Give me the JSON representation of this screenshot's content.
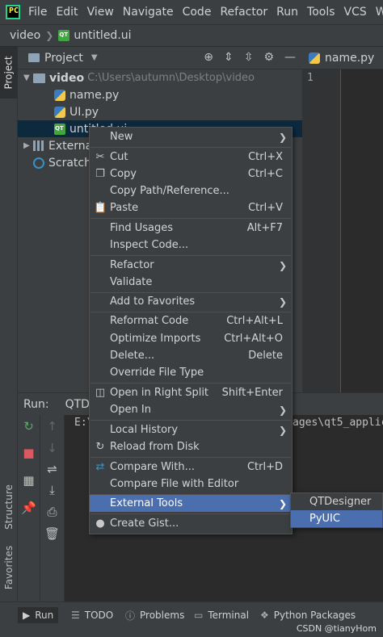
{
  "menubar": {
    "logo": "PC",
    "items": [
      "File",
      "Edit",
      "View",
      "Navigate",
      "Code",
      "Refactor",
      "Run",
      "Tools",
      "VCS",
      "Window"
    ]
  },
  "navbar": {
    "project": "video",
    "file": "untitled.ui"
  },
  "left_strip": {
    "project_tab": "Project",
    "structure_tab": "Structure",
    "favorites_tab": "Favorites"
  },
  "project_panel": {
    "title": "Project",
    "root": {
      "name": "video",
      "path": "C:\\Users\\autumn\\Desktop\\video"
    },
    "files": [
      "name.py",
      "UI.py",
      "untitled.ui"
    ],
    "external": "External Libraries",
    "scratches": "Scratches and Consoles"
  },
  "editor": {
    "tab": "name.py",
    "line_number": "1"
  },
  "run_panel": {
    "label": "Run:",
    "tab": "QTDesigner",
    "console_left": "E:\\",
    "console_right": "ages\\qt5_applic"
  },
  "context_menu": {
    "items": [
      {
        "label": "New",
        "shortcut": "",
        "submenu": true,
        "icon": ""
      },
      {
        "label": "Cut",
        "shortcut": "Ctrl+X",
        "icon": "scissors-icon"
      },
      {
        "label": "Copy",
        "shortcut": "Ctrl+C",
        "icon": "copy-icon"
      },
      {
        "label": "Copy Path/Reference...",
        "shortcut": ""
      },
      {
        "label": "Paste",
        "shortcut": "Ctrl+V",
        "icon": "paste-icon"
      },
      {
        "label": "Find Usages",
        "shortcut": "Alt+F7"
      },
      {
        "label": "Inspect Code...",
        "shortcut": ""
      },
      {
        "label": "Refactor",
        "shortcut": "",
        "submenu": true
      },
      {
        "label": "Validate",
        "shortcut": ""
      },
      {
        "label": "Add to Favorites",
        "shortcut": "",
        "submenu": true
      },
      {
        "label": "Reformat Code",
        "shortcut": "Ctrl+Alt+L"
      },
      {
        "label": "Optimize Imports",
        "shortcut": "Ctrl+Alt+O"
      },
      {
        "label": "Delete...",
        "shortcut": "Delete"
      },
      {
        "label": "Override File Type",
        "shortcut": ""
      },
      {
        "label": "Open in Right Split",
        "shortcut": "Shift+Enter",
        "icon": "split-icon"
      },
      {
        "label": "Open In",
        "shortcut": "",
        "submenu": true
      },
      {
        "label": "Local History",
        "shortcut": "",
        "submenu": true
      },
      {
        "label": "Reload from Disk",
        "shortcut": "",
        "icon": "reload-icon"
      },
      {
        "label": "Compare With...",
        "shortcut": "Ctrl+D",
        "icon": "compare-icon"
      },
      {
        "label": "Compare File with Editor",
        "shortcut": ""
      },
      {
        "label": "External Tools",
        "shortcut": "",
        "submenu": true
      },
      {
        "label": "Create Gist...",
        "shortcut": "",
        "icon": "github-icon"
      }
    ]
  },
  "submenu": {
    "items": [
      "QTDesigner",
      "PyUIC"
    ]
  },
  "statusbar": {
    "run": "Run",
    "todo": "TODO",
    "problems": "Problems",
    "terminal": "Terminal",
    "python_packages": "Python Packages",
    "watermark": "CSDN @tianyHom"
  },
  "colors": {
    "highlight": "#4b6eaf",
    "background": "#3c3f41",
    "editor": "#2b2b2b"
  }
}
